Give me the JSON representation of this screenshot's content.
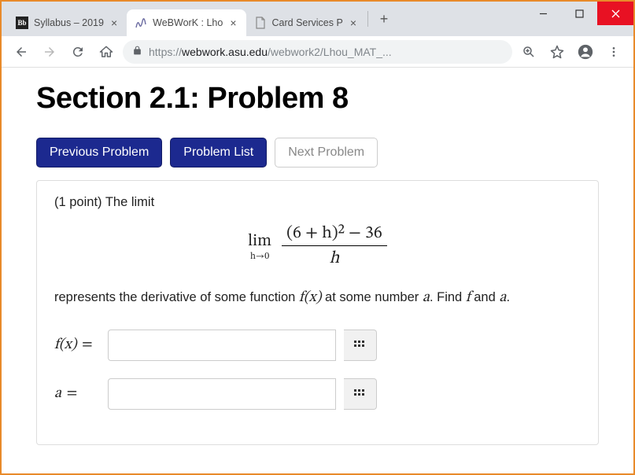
{
  "window": {
    "tabs": [
      {
        "title": "Syllabus – 2019",
        "icon": "bb"
      },
      {
        "title": "WeBWorK : Lho",
        "icon": "ww",
        "active": true
      },
      {
        "title": "Card Services P",
        "icon": "doc"
      }
    ],
    "controls": {
      "minimize": "minimize",
      "maximize": "maximize",
      "close": "close"
    }
  },
  "toolbar": {
    "url_scheme": "https://",
    "url_host": "webwork.asu.edu",
    "url_path": "/webwork2/Lhou_MAT_..."
  },
  "page": {
    "title": "Section 2.1: Problem 8",
    "nav": {
      "prev": "Previous Problem",
      "list": "Problem List",
      "next": "Next Problem"
    },
    "problem": {
      "intro": "(1 point) The limit",
      "limit": {
        "op": "lim",
        "sub": "h→0",
        "numerator": "(6 + h)² − 36",
        "denominator": "h"
      },
      "desc_pre": "represents the derivative of some function ",
      "desc_fx": "f(x)",
      "desc_mid": " at some number ",
      "desc_a": "a",
      "desc_post1": ". Find ",
      "desc_f": "f",
      "desc_post2": " and ",
      "desc_a2": "a",
      "desc_end": ".",
      "answers": [
        {
          "label": "f(x)",
          "value": ""
        },
        {
          "label": "a",
          "value": ""
        }
      ]
    }
  }
}
